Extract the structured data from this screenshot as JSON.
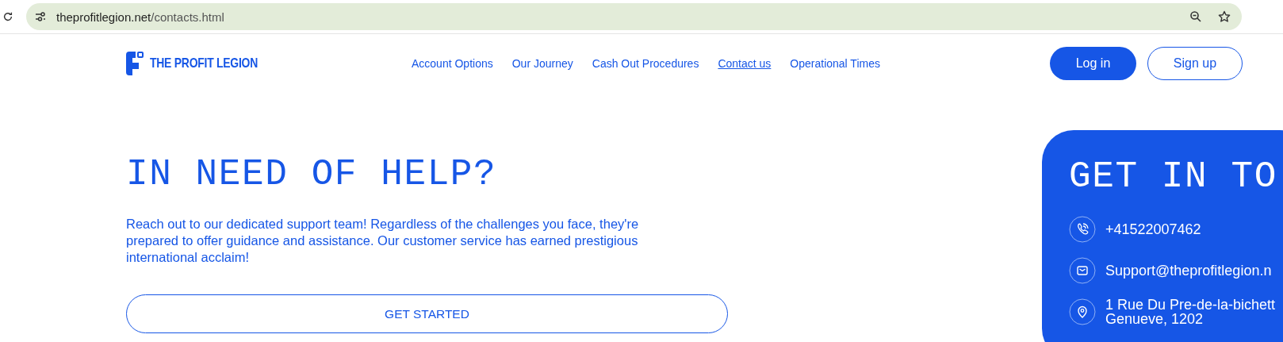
{
  "browser": {
    "url_host": "theprofitlegion.net",
    "url_path": "/contacts.html"
  },
  "brand": {
    "name": "THE PROFIT LEGION"
  },
  "nav": [
    {
      "label": "Account Options",
      "selected": false
    },
    {
      "label": "Our Journey",
      "selected": false
    },
    {
      "label": "Cash Out Procedures",
      "selected": false
    },
    {
      "label": "Contact us",
      "selected": true
    },
    {
      "label": "Operational Times",
      "selected": false
    }
  ],
  "auth": {
    "login": "Log in",
    "signup": "Sign up"
  },
  "hero": {
    "title": "IN NEED OF HELP?",
    "text": "Reach out to our dedicated support team! Regardless of the challenges you face, they're prepared to offer guidance and assistance. Our customer service has earned prestigious international acclaim!",
    "button": "GET STARTED"
  },
  "contact_card": {
    "title": "GET IN TO",
    "items": [
      {
        "kind": "phone",
        "lines": [
          "+41522007462"
        ]
      },
      {
        "kind": "email",
        "lines": [
          "Support@theprofitlegion.n"
        ]
      },
      {
        "kind": "address",
        "lines": [
          "1 Rue Du Pre-de-la-bichett",
          "Genueve, 1202"
        ]
      }
    ]
  }
}
